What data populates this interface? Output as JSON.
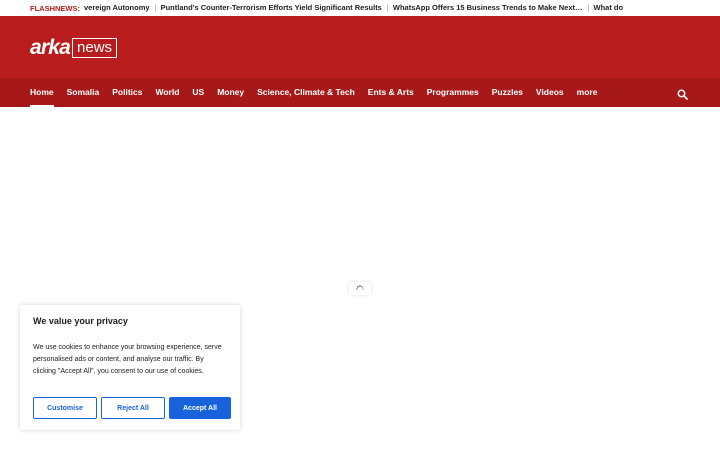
{
  "ticker": {
    "label": "FLASHNEWS:",
    "items": [
      "vereign Autonomy",
      "Puntland’s Counter-Terrorism Efforts Yield Significant Results",
      "WhatsApp Offers 15 Business Trends to Make Next…",
      "What do"
    ]
  },
  "logo": {
    "word": "arka",
    "box": "news"
  },
  "nav": {
    "items": [
      "Home",
      "Somalia",
      "Politics",
      "World",
      "US",
      "Money",
      "Science, Climate & Tech",
      "Ents & Arts",
      "Programmes",
      "Puzzles",
      "Videos",
      "more"
    ],
    "active_index": 0,
    "search_icon": "search-icon"
  },
  "loader_icon": "spinner-icon",
  "cookie": {
    "title": "We value your privacy",
    "text": "We use cookies to enhance your browsing experience, serve personalised ads or content, and analyse our traffic. By clicking \"Accept All\", you consent to our use of cookies.",
    "customise_label": "Customise",
    "reject_label": "Reject All",
    "accept_label": "Accept All"
  },
  "colors": {
    "brand_red": "#b81c1c",
    "nav_red": "#a71919",
    "accent_blue": "#1863dc"
  }
}
